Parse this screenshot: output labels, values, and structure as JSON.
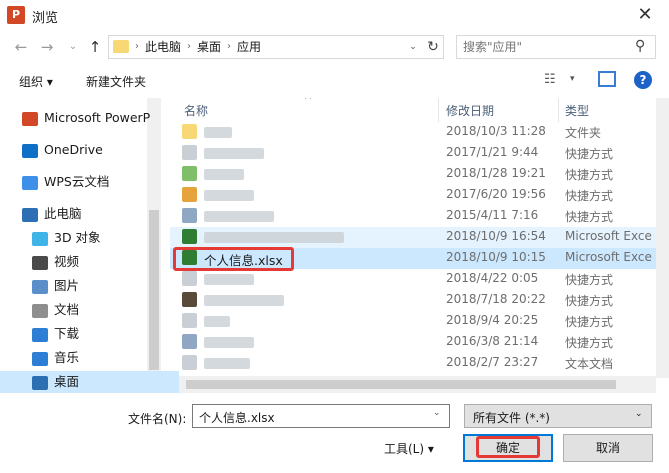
{
  "window": {
    "title": "浏览",
    "app_icon_letter": "P",
    "close_glyph": "✕"
  },
  "nav": {
    "back_glyph": "←",
    "forward_glyph": "→",
    "recent_glyph": "⌄",
    "up_glyph": "↑",
    "breadcrumbs": [
      "此电脑",
      "桌面",
      "应用"
    ],
    "separator_glyph": "›",
    "dropdown_glyph": "⌄",
    "refresh_glyph": "↻",
    "search_placeholder": "搜索\"应用\"",
    "search_glyph": "⚲"
  },
  "toolbar": {
    "organize": "组织 ▾",
    "new_folder": "新建文件夹",
    "view_glyph": "☷",
    "dropdown_glyph": "▾",
    "help": "?"
  },
  "sidebar": {
    "items": [
      {
        "label": "Microsoft PowerP",
        "icon": "powerpoint-icon",
        "color": "#d24726"
      },
      {
        "label": "OneDrive",
        "icon": "cloud-icon",
        "color": "#0f6fc6"
      },
      {
        "label": "WPS云文档",
        "icon": "cloud-icon",
        "color": "#3d8fe8"
      },
      {
        "label": "此电脑",
        "icon": "computer-icon",
        "color": "#2c6fb3"
      },
      {
        "label": "3D 对象",
        "icon": "cube-icon",
        "color": "#3fb4e8"
      },
      {
        "label": "视频",
        "icon": "film-icon",
        "color": "#4a4a4a"
      },
      {
        "label": "图片",
        "icon": "image-icon",
        "color": "#5b8fc9"
      },
      {
        "label": "文档",
        "icon": "document-icon",
        "color": "#8e8e8e"
      },
      {
        "label": "下载",
        "icon": "download-icon",
        "color": "#2d7fd6"
      },
      {
        "label": "音乐",
        "icon": "music-icon",
        "color": "#2d7fd6"
      },
      {
        "label": "桌面",
        "icon": "desktop-icon",
        "color": "#2c6fb3"
      }
    ]
  },
  "files": {
    "columns": [
      "名称",
      "修改日期",
      "类型"
    ],
    "sort_glyph": "^",
    "rows": [
      {
        "name": "",
        "date": "2018/10/3 11:28",
        "type": "文件夹",
        "icon_color": "#f8d775"
      },
      {
        "name": "",
        "date": "2017/1/21 9:44",
        "type": "快捷方式",
        "icon_color": "#c9cfd4"
      },
      {
        "name": "",
        "date": "2018/1/28 19:21",
        "type": "快捷方式",
        "icon_color": "#7fbf6a"
      },
      {
        "name": "",
        "date": "2017/6/20 19:56",
        "type": "快捷方式",
        "icon_color": "#e6a23c"
      },
      {
        "name": "",
        "date": "2015/4/11 7:16",
        "type": "快捷方式",
        "icon_color": "#8fa7c2"
      },
      {
        "name": "",
        "date": "2018/10/9 16:54",
        "type": "Microsoft Exce",
        "icon_color": "#2e7d32"
      },
      {
        "name": "个人信息.xlsx",
        "date": "2018/10/9 10:15",
        "type": "Microsoft Exce",
        "icon_color": "#2e7d32",
        "selected": true
      },
      {
        "name": "",
        "date": "2018/4/22 0:05",
        "type": "快捷方式",
        "icon_color": "#c9cfd4"
      },
      {
        "name": "",
        "date": "2018/7/18 20:22",
        "type": "快捷方式",
        "icon_color": "#5a4a3a"
      },
      {
        "name": "",
        "date": "2018/9/4 20:25",
        "type": "快捷方式",
        "icon_color": "#c9cfd4"
      },
      {
        "name": "",
        "date": "2016/3/8 21:14",
        "type": "快捷方式",
        "icon_color": "#8fa7c2"
      },
      {
        "name": "",
        "date": "2018/2/7 23:27",
        "type": "文本文档",
        "icon_color": "#c9cfd4"
      }
    ]
  },
  "footer": {
    "filename_label": "文件名(N):",
    "filename_value": "个人信息.xlsx",
    "filetype_value": "所有文件 (*.*)",
    "dropdown_glyph": "⌄",
    "tools_label": "工具(L)    ▾",
    "ok_label": "确定",
    "cancel_label": "取消"
  },
  "colors": {
    "selection": "#cce8ff",
    "accent": "#0078d7",
    "highlight_box": "#e53935"
  }
}
